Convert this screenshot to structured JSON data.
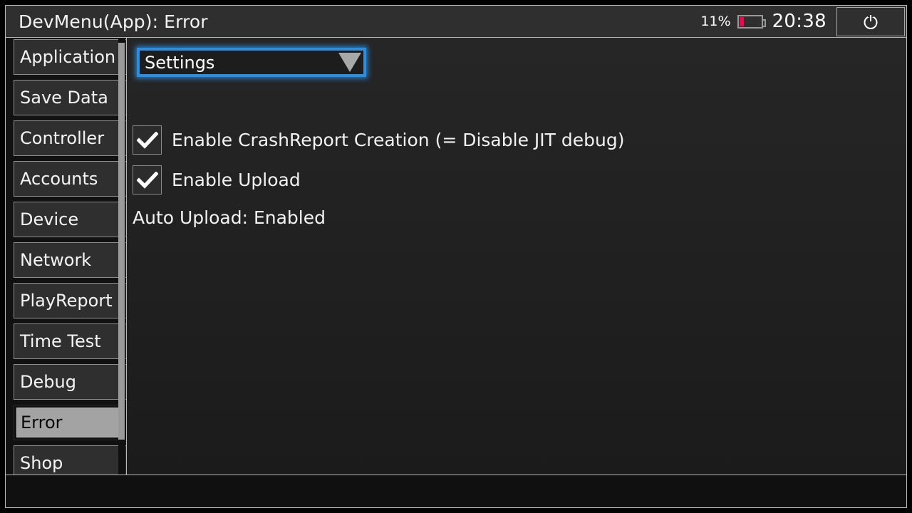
{
  "window": {
    "title": "DevMenu(App): Error"
  },
  "status_bar": {
    "battery_percent": "11%",
    "battery_level": 11,
    "battery_color": "#ea0a50",
    "clock": "20:38",
    "power_icon": "power-icon"
  },
  "sidebar": {
    "items": [
      {
        "label": "Application",
        "selected": false
      },
      {
        "label": "Save Data",
        "selected": false
      },
      {
        "label": "Controller",
        "selected": false
      },
      {
        "label": "Accounts",
        "selected": false
      },
      {
        "label": "Device",
        "selected": false
      },
      {
        "label": "Network",
        "selected": false
      },
      {
        "label": "PlayReport",
        "selected": false
      },
      {
        "label": "Time Test",
        "selected": false
      },
      {
        "label": "Debug",
        "selected": false
      },
      {
        "label": "Error",
        "selected": true
      },
      {
        "label": "Shop",
        "selected": false
      }
    ],
    "scrollbar": "vertical-scrollbar"
  },
  "content": {
    "dropdown": {
      "selected_value": "Settings",
      "caret_icon": "chevron-down-icon",
      "focus_color": "#2a8fe0"
    },
    "checkboxes": [
      {
        "label": "Enable CrashReport Creation (= Disable JIT debug)",
        "checked": true
      },
      {
        "label": "Enable Upload",
        "checked": true
      }
    ],
    "status_text": "Auto Upload: Enabled"
  }
}
